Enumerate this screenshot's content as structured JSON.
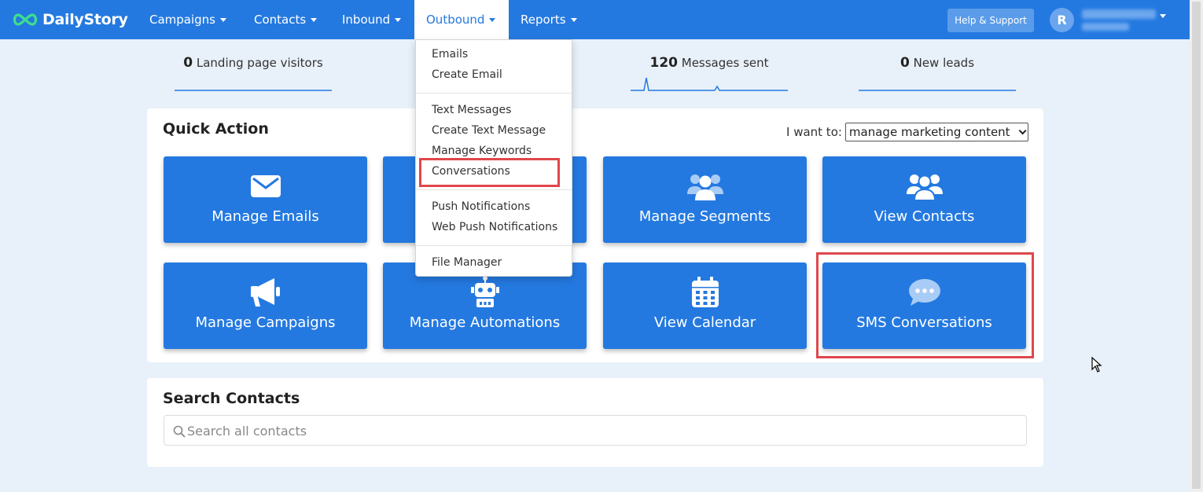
{
  "navbar": {
    "brand": "DailyStory",
    "items": [
      {
        "label": "Campaigns"
      },
      {
        "label": "Contacts"
      },
      {
        "label": "Inbound"
      },
      {
        "label": "Outbound"
      },
      {
        "label": "Reports"
      }
    ],
    "help_label": "Help & Support",
    "avatar_initial": "R",
    "accent_color": "#2479e0"
  },
  "stats": [
    {
      "value": "0",
      "label": " Landing page visitors"
    },
    {
      "value": "120",
      "label": " Messages sent"
    },
    {
      "value": "0",
      "label": " New leads"
    }
  ],
  "quick_action": {
    "title": "Quick Action",
    "i_want_label": "I want to:",
    "i_want_value": "manage marketing content",
    "tiles": [
      {
        "label": "Manage Emails",
        "icon": "envelope-icon"
      },
      {
        "label": "",
        "icon": "hidden"
      },
      {
        "label": "Manage Segments",
        "icon": "users-icon"
      },
      {
        "label": "View Contacts",
        "icon": "users-icon"
      },
      {
        "label": "Manage Campaigns",
        "icon": "megaphone-icon"
      },
      {
        "label": "Manage Automations",
        "icon": "robot-icon"
      },
      {
        "label": "View Calendar",
        "icon": "calendar-icon"
      },
      {
        "label": "SMS Conversations",
        "icon": "chat-bubble-icon"
      }
    ]
  },
  "outbound_menu": {
    "groups": [
      [
        "Emails",
        "Create Email"
      ],
      [
        "Text Messages",
        "Create Text Message",
        "Manage Keywords",
        "Conversations"
      ],
      [
        "Push Notifications",
        "Web Push Notifications"
      ],
      [
        "File Manager"
      ]
    ]
  },
  "search": {
    "title": "Search Contacts",
    "placeholder": "Search all contacts"
  }
}
